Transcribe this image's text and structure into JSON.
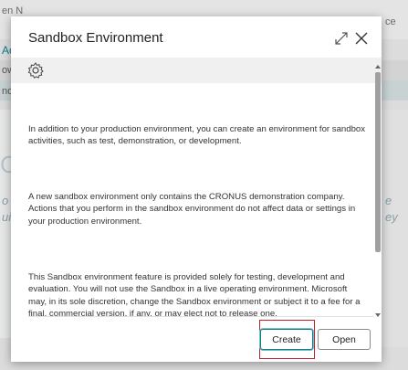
{
  "background": {
    "top_left_text": "en N",
    "top_right_text": "ce",
    "row1_left": "Ac",
    "row2_left": "ow",
    "row3_left": "nd",
    "big_letter": "C",
    "italic_left_1": "o",
    "italic_left_2": "ui",
    "italic_right_1": "e",
    "italic_right_2": "ey"
  },
  "dialog": {
    "title": "Sandbox Environment",
    "icons": [
      "expand-icon",
      "close-icon",
      "gear-icon"
    ],
    "paragraphs": [
      "In addition to your production environment, you can create an environment for sandbox activities, such as test, demonstration, or development.",
      "A new sandbox environment only contains the CRONUS demonstration company. Actions that you perform in the sandbox environment do not affect data or settings in your production environment.",
      "This Sandbox environment feature is provided solely for testing, development and evaluation. You will not use the Sandbox in a live operating environment. Microsoft may, in its sole discretion, change the Sandbox environment or subject it to a fee for a final, commercial version, if any, or may elect not to release one."
    ],
    "buttons": {
      "create": "Create",
      "open": "Open"
    }
  },
  "colors": {
    "accent": "#0a7e8c",
    "highlight": "#c0202a"
  }
}
